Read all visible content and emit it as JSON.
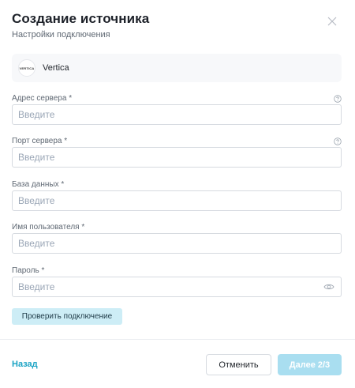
{
  "header": {
    "title": "Создание источника",
    "subtitle": "Настройки подключения"
  },
  "source": {
    "logo_text": "VERTICA",
    "name": "Vertica"
  },
  "fields": [
    {
      "label": "Адрес сервера *",
      "placeholder": "Введите",
      "value": "",
      "has_help": true
    },
    {
      "label": "Порт сервера *",
      "placeholder": "Введите",
      "value": "",
      "has_help": true
    },
    {
      "label": "База данных *",
      "placeholder": "Введите",
      "value": ""
    },
    {
      "label": "Имя пользователя *",
      "placeholder": "Введите",
      "value": ""
    },
    {
      "label": "Пароль *",
      "placeholder": "Введите",
      "value": "",
      "type": "password"
    }
  ],
  "actions": {
    "check_connection": "Проверить подключение",
    "back": "Назад",
    "cancel": "Отменить",
    "next": "Далее 2/3"
  },
  "colors": {
    "accent": "#1aa3c4",
    "next_disabled_bg": "#a9def0",
    "check_bg": "#cdedf6"
  },
  "icons": {
    "close": "close-icon",
    "help": "question-circle-icon",
    "eye": "eye-icon"
  }
}
